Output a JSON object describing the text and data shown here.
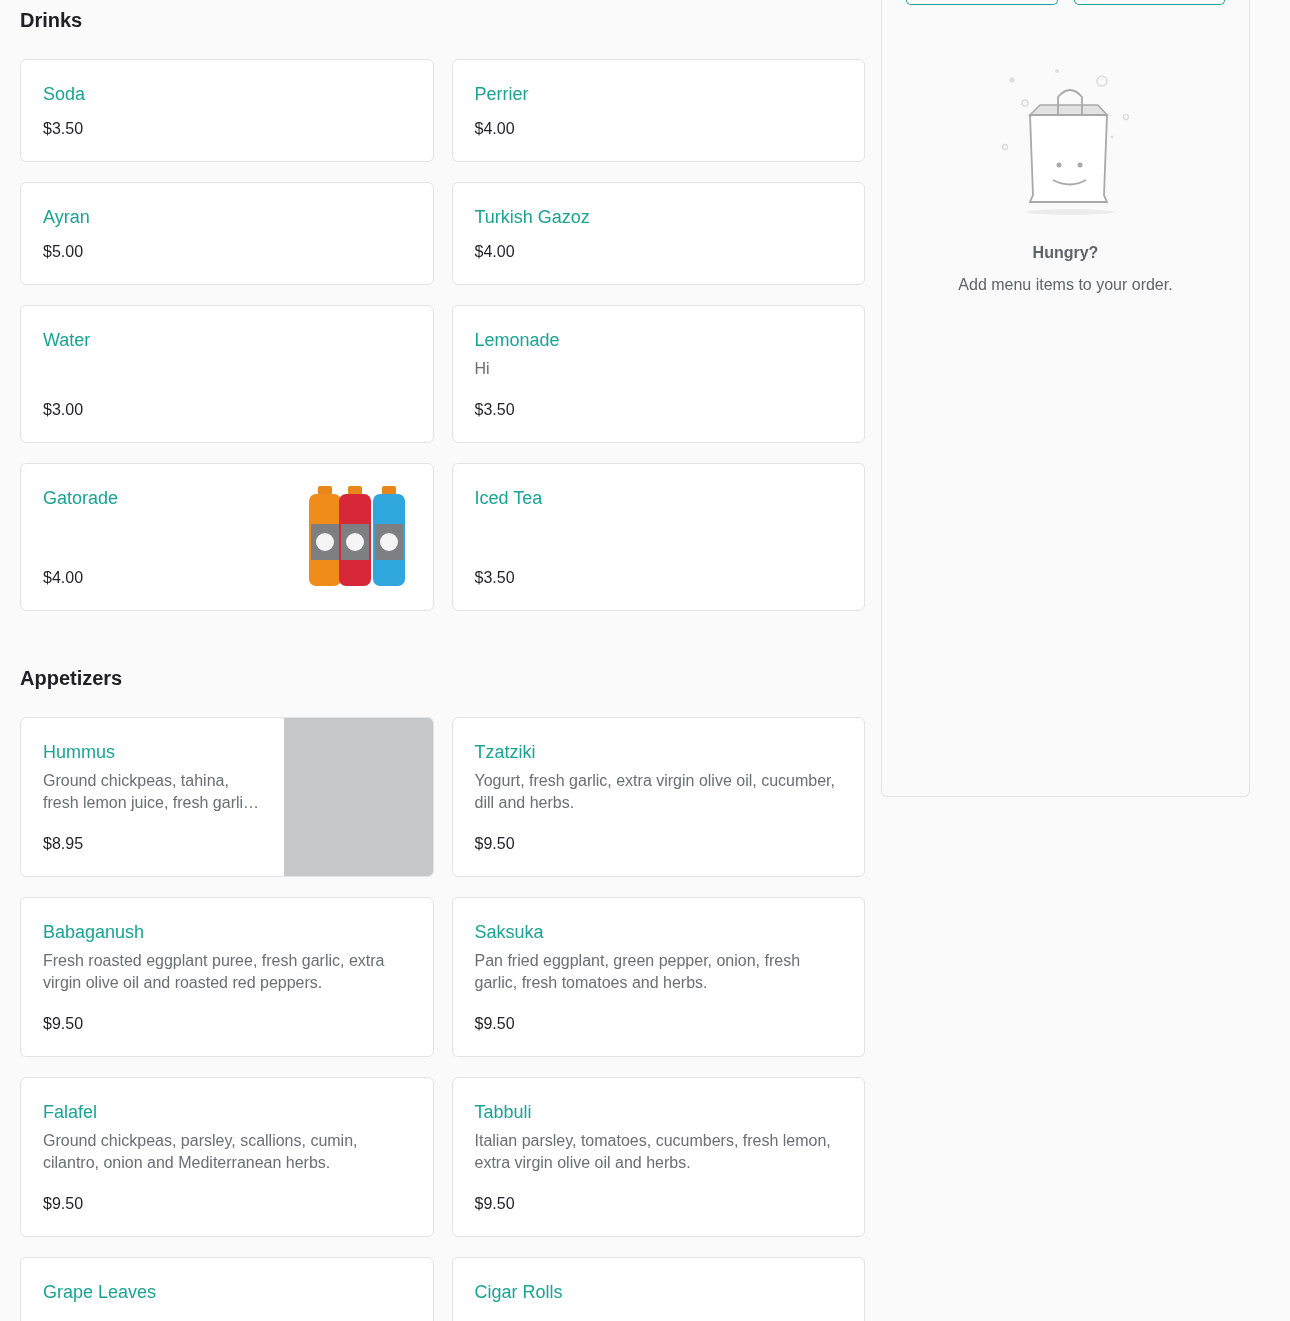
{
  "menu": [
    {
      "title": "Drinks",
      "items": [
        {
          "name": "Soda",
          "price": "$3.50"
        },
        {
          "name": "Perrier",
          "price": "$4.00"
        },
        {
          "name": "Ayran",
          "price": "$5.00"
        },
        {
          "name": "Turkish Gazoz",
          "price": "$4.00"
        },
        {
          "name": "Water",
          "price": "$3.00"
        },
        {
          "name": "Lemonade",
          "description": "Hi",
          "price": "$3.50"
        },
        {
          "name": "Gatorade",
          "price": "$4.00",
          "kind": "picture"
        },
        {
          "name": "Iced Tea",
          "price": "$3.50"
        }
      ]
    },
    {
      "title": "Appetizers",
      "items": [
        {
          "name": "Hummus",
          "description": "Ground chickpeas, tahina, fresh lemon juice, fresh garli…",
          "price": "$8.95",
          "kind": "placeholder"
        },
        {
          "name": "Tzatziki",
          "description": "Yogurt, fresh garlic, extra virgin olive oil, cucumber, dill and herbs.",
          "price": "$9.50"
        },
        {
          "name": "Babaganush",
          "description": "Fresh roasted eggplant puree, fresh garlic, extra virgin olive oil and roasted red peppers.",
          "price": "$9.50"
        },
        {
          "name": "Saksuka",
          "description": "Pan fried eggplant, green pepper, onion, fresh garlic, fresh tomatoes and herbs.",
          "price": "$9.50"
        },
        {
          "name": "Falafel",
          "description": "Ground chickpeas, parsley, scallions, cumin, cilantro, onion and Mediterranean herbs.",
          "price": "$9.50"
        },
        {
          "name": "Tabbuli",
          "description": "Italian parsley, tomatoes, cucumbers, fresh lemon, extra virgin olive oil and herbs.",
          "price": "$9.50"
        },
        {
          "name": "Grape Leaves"
        },
        {
          "name": "Cigar Rolls"
        }
      ]
    }
  ],
  "order": {
    "empty_title": "Hungry?",
    "empty_text": "Add menu items to your order."
  }
}
